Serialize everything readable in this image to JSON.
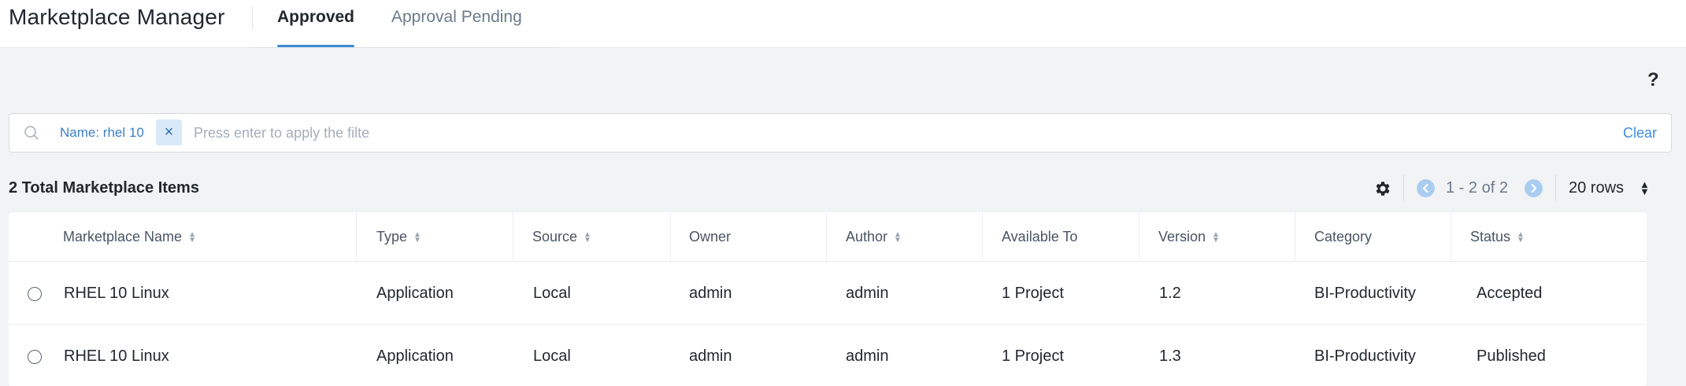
{
  "header": {
    "app_title": "Marketplace Manager",
    "tabs": [
      {
        "label": "Approved",
        "active": true
      },
      {
        "label": "Approval Pending",
        "active": false
      }
    ],
    "accent_color": "#3d8bd8"
  },
  "help": {
    "label": "?"
  },
  "filter": {
    "chip_label": "Name: rhel 10",
    "chip_remove": "×",
    "placeholder": "Press enter to apply the filte",
    "clear_label": "Clear"
  },
  "toolbar": {
    "total_label": "2 Total Marketplace Items",
    "settings_icon": "gear-icon",
    "page_range": "1 - 2 of 2",
    "rows_label": "20 rows"
  },
  "table": {
    "columns": [
      {
        "label": "Marketplace Name",
        "sortable": true
      },
      {
        "label": "Type",
        "sortable": true
      },
      {
        "label": "Source",
        "sortable": true
      },
      {
        "label": "Owner",
        "sortable": false
      },
      {
        "label": "Author",
        "sortable": true
      },
      {
        "label": "Available To",
        "sortable": false
      },
      {
        "label": "Version",
        "sortable": true
      },
      {
        "label": "Category",
        "sortable": false
      },
      {
        "label": "Status",
        "sortable": true
      }
    ],
    "rows": [
      {
        "name": "RHEL 10 Linux",
        "type": "Application",
        "source": "Local",
        "owner": "admin",
        "author": "admin",
        "available_to": "1 Project",
        "version": "1.2",
        "category": "BI-Productivity",
        "status": "Accepted"
      },
      {
        "name": "RHEL 10 Linux",
        "type": "Application",
        "source": "Local",
        "owner": "admin",
        "author": "admin",
        "available_to": "1 Project",
        "version": "1.3",
        "category": "BI-Productivity",
        "status": "Published"
      }
    ]
  }
}
